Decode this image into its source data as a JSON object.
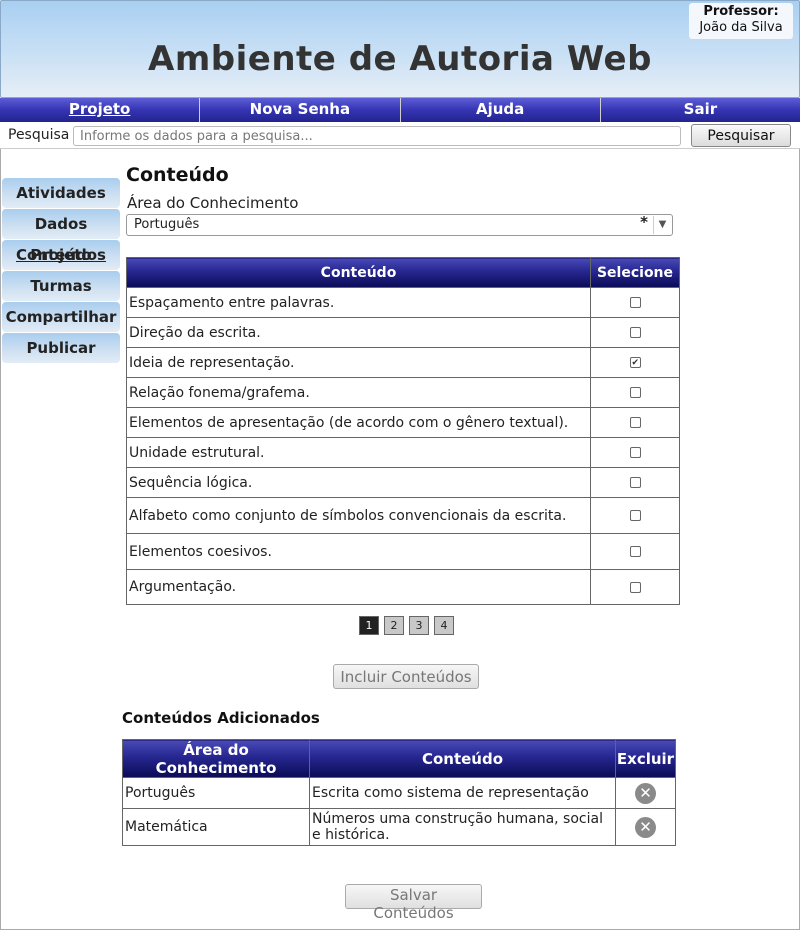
{
  "header": {
    "title": "Ambiente de Autoria Web",
    "professor_label": "Professor:",
    "professor_name": "João da Silva"
  },
  "nav": {
    "items": [
      {
        "label": "Projeto",
        "active": true
      },
      {
        "label": "Nova Senha"
      },
      {
        "label": "Ajuda"
      },
      {
        "label": "Sair"
      }
    ]
  },
  "search": {
    "label": "Pesquisa",
    "placeholder": "Informe os dados para a pesquisa...",
    "button": "Pesquisar"
  },
  "sidebar": {
    "items": [
      {
        "label": "Atividades"
      },
      {
        "label": "Dados Projeto"
      },
      {
        "label": "Conteúdos",
        "active": true
      },
      {
        "label": "Turmas"
      },
      {
        "label": "Compartilhar"
      },
      {
        "label": "Publicar"
      }
    ]
  },
  "content": {
    "title": "Conteúdo",
    "area_label": "Área do Conhecimento",
    "area_value": "Português",
    "required_mark": "*",
    "table": {
      "headers": [
        "Conteúdo",
        "Selecione"
      ],
      "rows": [
        {
          "text": "Espaçamento entre palavras.",
          "checked": false
        },
        {
          "text": "Direção da escrita.",
          "checked": false
        },
        {
          "text": "Ideia de representação.",
          "checked": true
        },
        {
          "text": "Relação fonema/grafema.",
          "checked": false
        },
        {
          "text": "Elementos de apresentação (de acordo com o gênero textual).",
          "checked": false
        },
        {
          "text": "Unidade estrutural.",
          "checked": false
        },
        {
          "text": "Sequência lógica.",
          "checked": false
        },
        {
          "text": "Alfabeto como conjunto de símbolos convencionais da escrita.",
          "checked": false
        },
        {
          "text": "Elementos coesivos.",
          "checked": false
        },
        {
          "text": "Argumentação.",
          "checked": false
        }
      ]
    },
    "pages": [
      "1",
      "2",
      "3",
      "4"
    ],
    "current_page": "1",
    "include_button": "Incluir Conteúdos",
    "added_title": "Conteúdos Adicionados",
    "added_table": {
      "headers": [
        "Área do Conhecimento",
        "Conteúdo",
        "Excluir"
      ],
      "rows": [
        {
          "area": "Português",
          "content": "Escrita como sistema de representação"
        },
        {
          "area": "Matemática",
          "content": "Números uma construção humana, social e histórica."
        }
      ]
    },
    "save_button": "Salvar Conteúdos"
  },
  "colors": {
    "nav_blue": "#3535b3",
    "header_blue": "#a9cff2",
    "table_header_dark": "#0b0b55"
  }
}
